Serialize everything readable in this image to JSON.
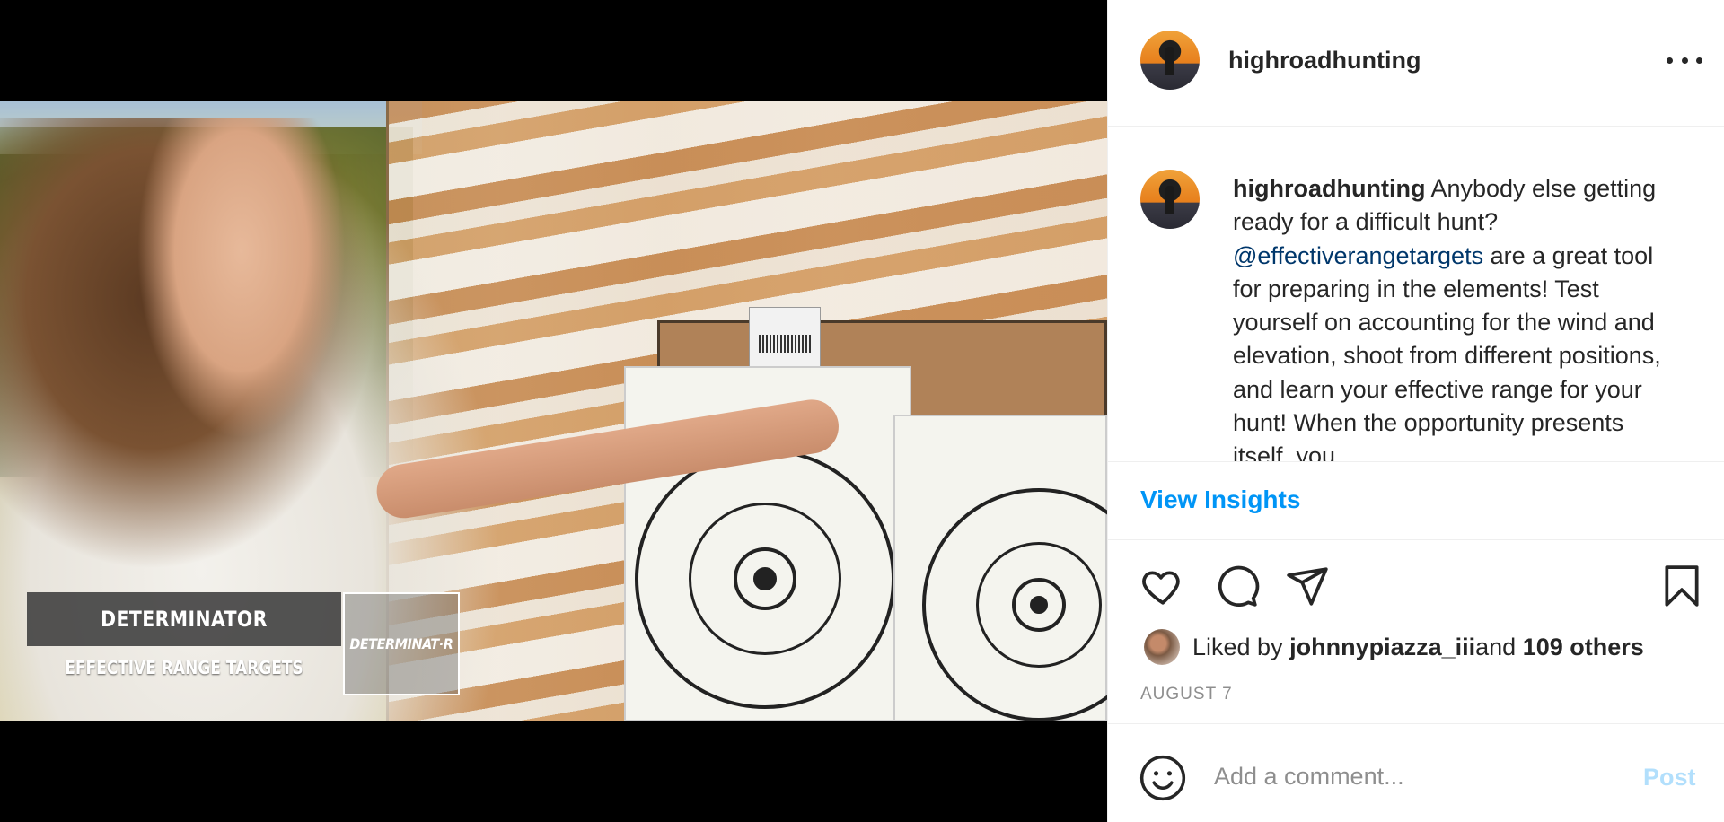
{
  "post": {
    "username": "highroadhunting",
    "caption": {
      "username": "highroadhunting",
      "text_before_mention": " Anybody else getting ready for a difficult hunt? ",
      "mention": "@effectiverangetargets",
      "text_after_mention": " are a great tool for preparing in the elements! Test yourself on accounting for the wind and elevation, shoot from different positions, and learn your effective range for your hunt! When the opportunity presents itself, you"
    },
    "insights_label": "View Insights",
    "likes": {
      "prefix": "Liked by ",
      "user": "johnnypiazza_iii",
      "connector": " and ",
      "others": "109 others"
    },
    "date": "AUGUST 7"
  },
  "video_overlay": {
    "title": "DETERMINATOR",
    "subtitle": "EFFECTIVE RANGE TARGETS",
    "logo_text": "DETERMINAT·R"
  },
  "comment": {
    "placeholder": "Add a comment...",
    "post_label": "Post"
  },
  "icons": {
    "more": "more-options-icon",
    "like": "heart-icon",
    "comment": "comment-bubble-icon",
    "share": "paper-plane-icon",
    "save": "bookmark-icon",
    "emoji": "smiley-icon"
  },
  "colors": {
    "link_blue": "#0095f6",
    "mention_blue": "#00376b",
    "post_disabled": "#b2dffc",
    "muted_text": "#8e8e8e",
    "text": "#262626"
  }
}
